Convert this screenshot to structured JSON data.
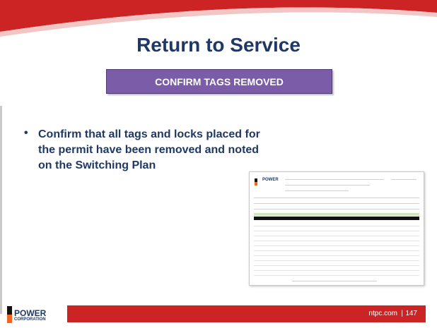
{
  "slide": {
    "title": "Return to Service",
    "banner": "CONFIRM TAGS REMOVED",
    "bullets": [
      "Confirm that all tags and locks placed for the permit have been removed and noted on the Switching Plan"
    ],
    "doc_thumbnail": {
      "logo": "POWER"
    },
    "footer": {
      "logo_main": "POWER",
      "logo_sub": "CORPORATION",
      "url": "ntpc.com",
      "separator": "|",
      "page": "147"
    }
  },
  "colors": {
    "title": "#1f3864",
    "banner": "#7a5ca8",
    "footer_bar": "#cc2324",
    "swoosh": "#cc2324",
    "logo_orange": "#f26522"
  }
}
